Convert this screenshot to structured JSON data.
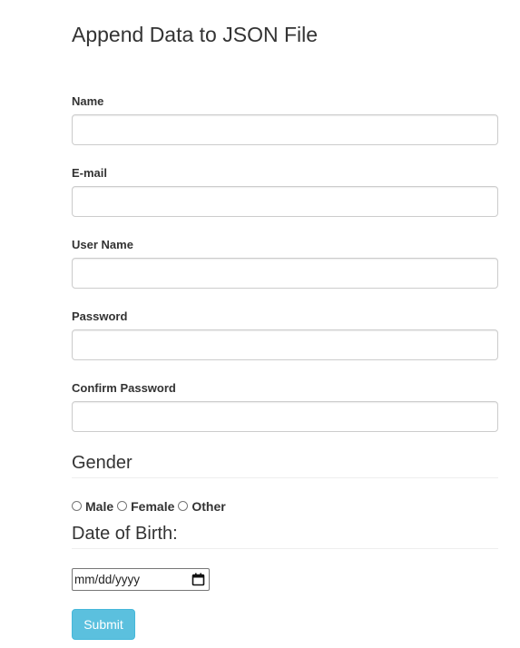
{
  "page_title": "Append Data to JSON File",
  "fields": {
    "name": {
      "label": "Name",
      "value": ""
    },
    "email": {
      "label": "E-mail",
      "value": ""
    },
    "username": {
      "label": "User Name",
      "value": ""
    },
    "password": {
      "label": "Password",
      "value": ""
    },
    "confirm_password": {
      "label": "Confirm Password",
      "value": ""
    }
  },
  "gender": {
    "heading": "Gender",
    "options": [
      "Male",
      "Female",
      "Other"
    ],
    "selected": null
  },
  "dob": {
    "heading": "Date of Birth:",
    "placeholder": "mm/dd/yyyy"
  },
  "submit_label": "Submit",
  "colors": {
    "submit_bg": "#5bc0de",
    "submit_border": "#46b8da",
    "text": "#333333",
    "input_border": "#cccccc"
  }
}
